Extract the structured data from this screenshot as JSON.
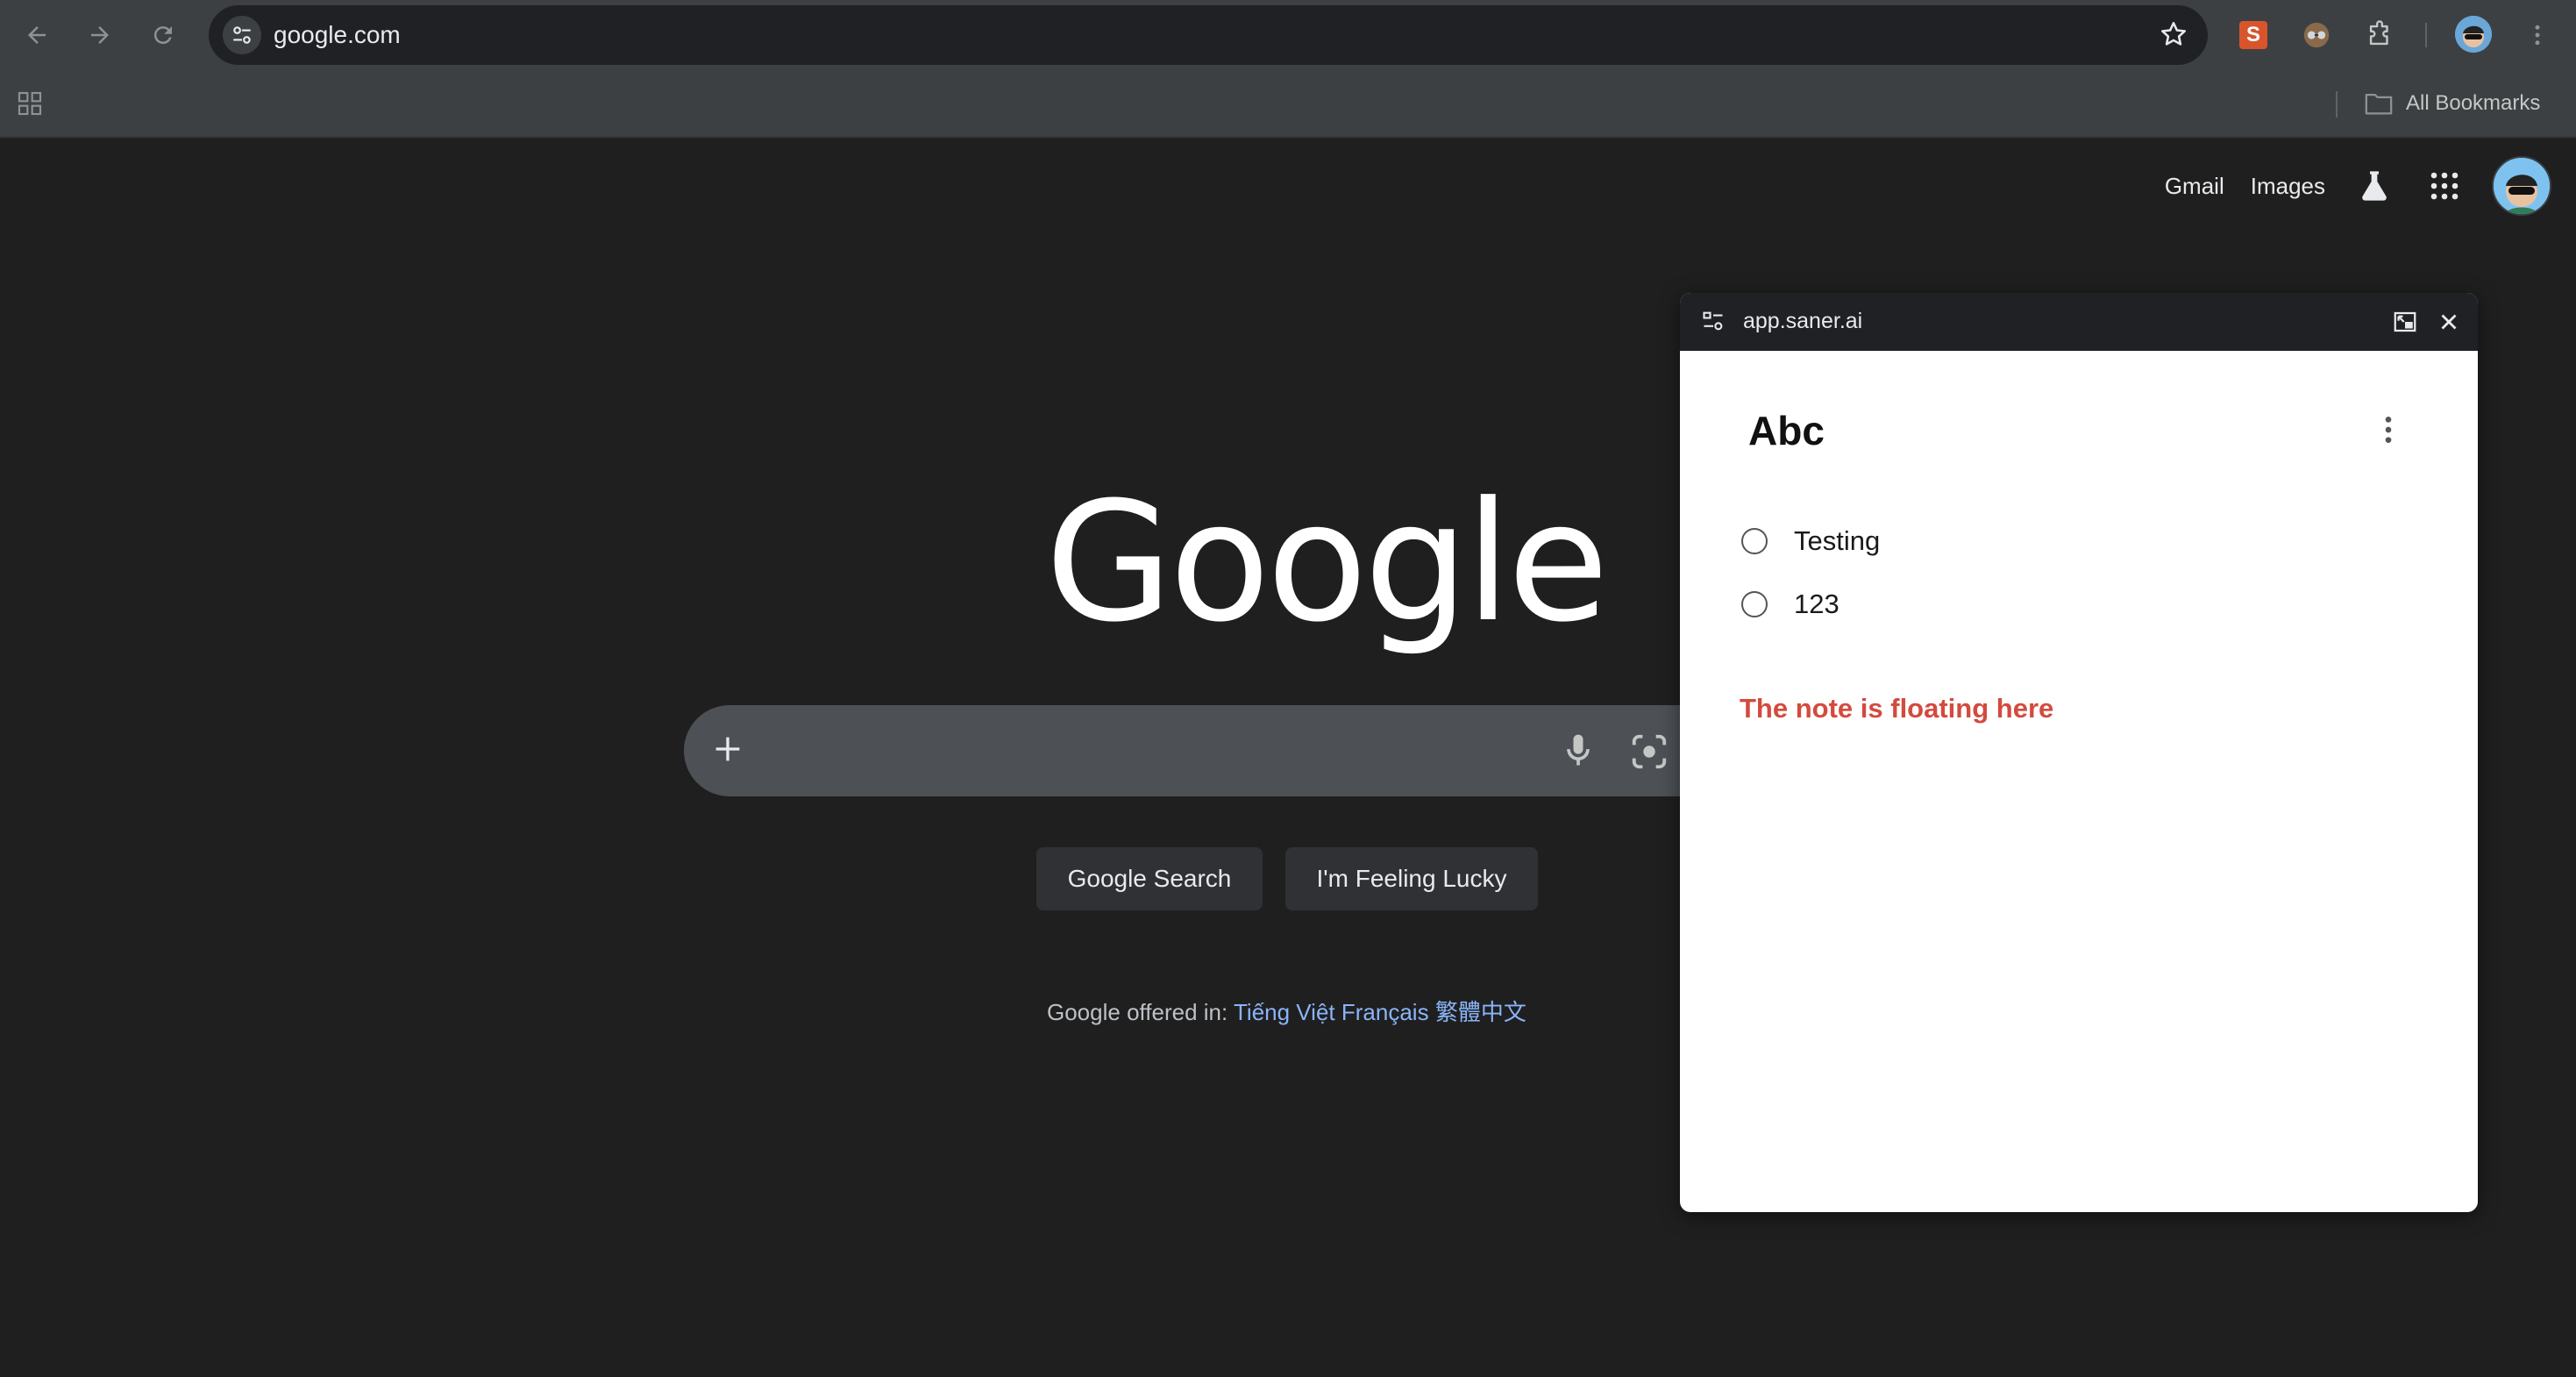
{
  "browser": {
    "url": "google.com",
    "bookmarks_bar": {
      "all_bookmarks_label": "All Bookmarks"
    },
    "extension_s_label": "S"
  },
  "google": {
    "nav": {
      "gmail": "Gmail",
      "images": "Images"
    },
    "logo_text": "Google",
    "search": {
      "placeholder": ""
    },
    "buttons": {
      "search": "Google Search",
      "lucky": "I'm Feeling Lucky"
    },
    "offered": {
      "prefix": "Google offered in:",
      "languages": [
        "Tiếng Việt",
        "Français",
        "繁體中文"
      ]
    }
  },
  "floating_note": {
    "origin": "app.saner.ai",
    "title": "Abc",
    "todos": [
      {
        "label": "Testing",
        "checked": false
      },
      {
        "label": "123",
        "checked": false
      }
    ],
    "annotation": "The note is floating here",
    "annotation_color": "#d34a3e"
  },
  "colors": {
    "chrome_toolbar": "#3c4043",
    "page_background": "#1f1f1f",
    "link": "#8ab4f8"
  }
}
